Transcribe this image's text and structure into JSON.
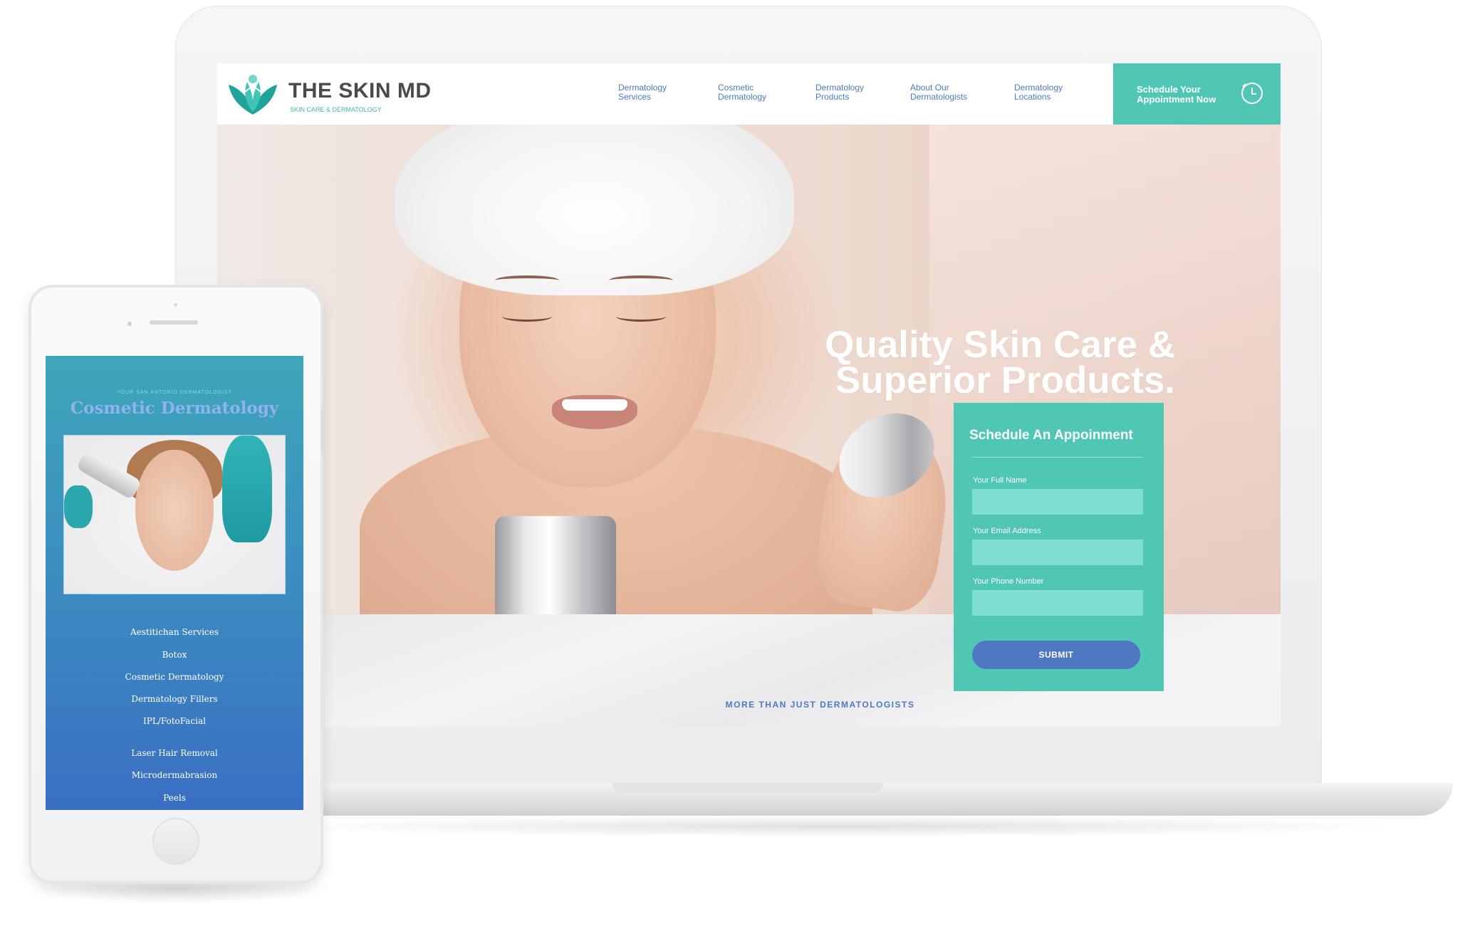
{
  "desktop": {
    "logo": {
      "name": "THE SKIN MD",
      "tagline": "SKIN CARE & DERMATOLOGY"
    },
    "nav": [
      {
        "label": "Dermatology\nServices"
      },
      {
        "label": "Cosmetic\nDermatology"
      },
      {
        "label": "Dermatology\nProducts"
      },
      {
        "label": "About Our\nDermatologists"
      },
      {
        "label": "Dermatology\nLocations"
      }
    ],
    "cta": {
      "label": "Schedule Your\nAppointment Now",
      "icon": "clock-icon"
    },
    "hero": {
      "title": "Quality Skin Care &\nSuperior Products."
    },
    "form": {
      "title": "Schedule An Appoinment",
      "fields": [
        {
          "label": "Your Full Name",
          "value": ""
        },
        {
          "label": "Your Email Address",
          "value": ""
        },
        {
          "label": "Your Phone Number",
          "value": ""
        }
      ],
      "submit": "SUBMIT"
    },
    "tagline": "MORE THAN JUST DERMATOLOGISTS"
  },
  "mobile": {
    "eyebrow": "YOUR SAN ANTONIO DERMATOLOGIST",
    "title": "Cosmetic Dermatology",
    "services": [
      "Aestitichan Services",
      "Botox",
      "Cosmetic Dermatology",
      "Dermatology Fillers",
      "IPL/FotoFacial",
      "Laser Hair Removal",
      "Microdermabrasion",
      "Peels"
    ]
  },
  "colors": {
    "teal": "#4fc7b4",
    "teal_light": "#7fe0d2",
    "blue": "#4f78c3",
    "mobile_gradient_top": "#3ea7b8",
    "mobile_gradient_bottom": "#3a6fc3"
  }
}
